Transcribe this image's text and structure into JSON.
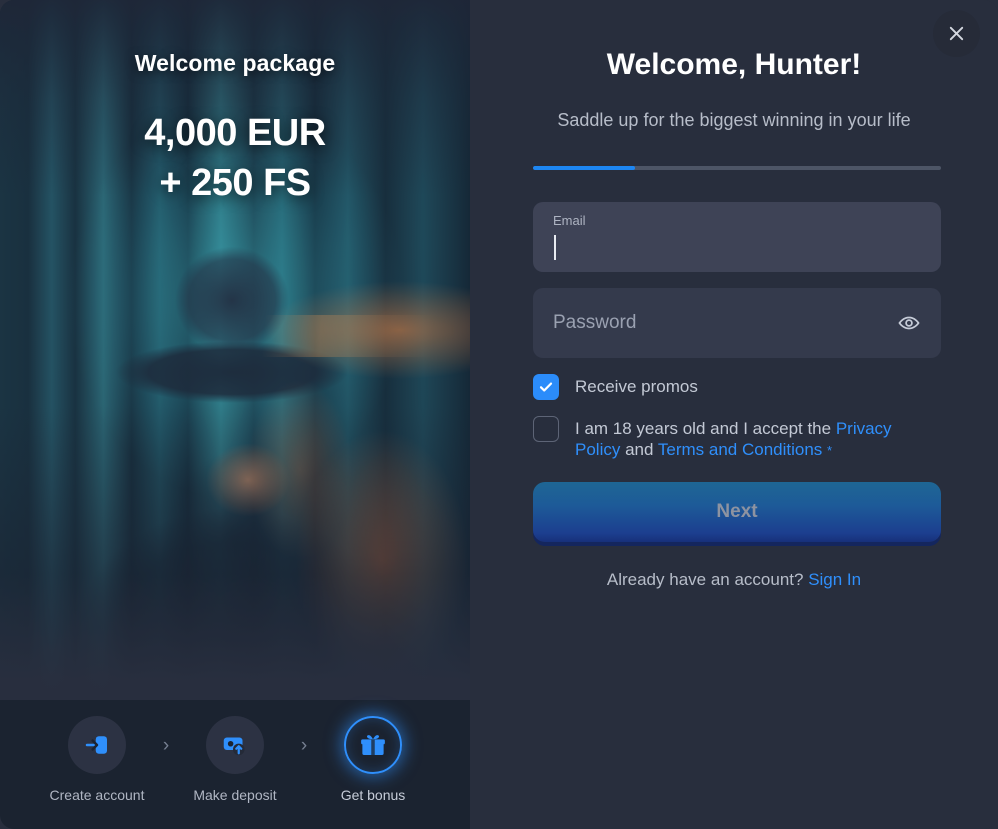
{
  "promo": {
    "title": "Welcome package",
    "amount_line1": "4,000 EUR",
    "amount_line2": "+ 250 FS"
  },
  "steps": {
    "separator": "›",
    "items": [
      {
        "label": "Create account",
        "icon": "login-icon",
        "active": false
      },
      {
        "label": "Make deposit",
        "icon": "deposit-card-icon",
        "active": false
      },
      {
        "label": "Get bonus",
        "icon": "gift-icon",
        "active": true
      }
    ]
  },
  "header": {
    "title": "Welcome, Hunter!",
    "subtitle": "Saddle up for the biggest winning in your life",
    "close_icon": "close-icon",
    "progress_percent": 25
  },
  "form": {
    "email": {
      "label": "Email",
      "value": "",
      "focused": true
    },
    "password": {
      "placeholder": "Password",
      "value": "",
      "toggle_icon": "eye-icon"
    },
    "promos_checkbox": {
      "label": "Receive promos",
      "checked": true
    },
    "terms_checkbox": {
      "checked": false,
      "text_part1": "I am 18 years old and I accept the ",
      "link1": "Privacy Policy",
      "text_part2": " and ",
      "link2": "Terms and Conditions",
      "required_mark": "*"
    },
    "submit_label": "Next"
  },
  "footer": {
    "account_prompt": "Already have an account? ",
    "signin_link": "Sign In"
  },
  "colors": {
    "accent_blue": "#2f8ffb",
    "panel_bg": "#282e3d",
    "field_focused": "#3e4356",
    "field_plain": "#343a4c",
    "progress_track": "#4d5566"
  }
}
